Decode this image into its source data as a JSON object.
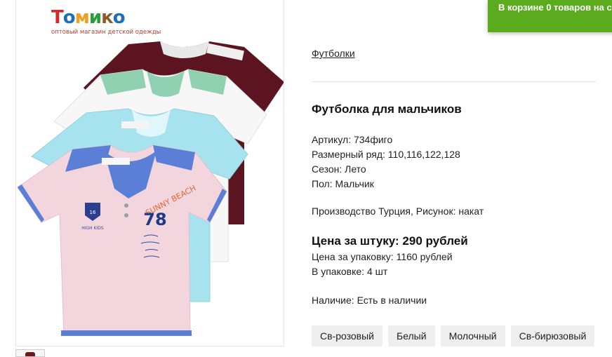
{
  "logo": {
    "brand": "Томико",
    "letters": [
      "Т",
      "о",
      "м",
      "и",
      "к",
      "о"
    ],
    "tagline": "оптовый магазин детской одежды"
  },
  "product_image": {
    "print_text": "SUNNY BEACH",
    "print_number": "78",
    "badge_text": "HIGH KIDS"
  },
  "cart": {
    "prefix": "В корзине",
    "count": "0 товаров",
    "suffix": "на су"
  },
  "breadcrumb": "Футболки",
  "title": "Футболка для мальчиков",
  "props": {
    "article": "Артикул: 734фиго",
    "sizes": "Размерный ряд: 110,116,122,128",
    "season": "Сезон: Лето",
    "gender": "Пол: Мальчик"
  },
  "production": "Производство Турция, Рисунок: накат",
  "price": {
    "per_item": "Цена за штуку: 290 рублей",
    "per_pack": "Цена за упаковку: 1160 рублей",
    "pack_size": "В упаковке: 4 шт"
  },
  "stock": "Наличие: Есть в наличии",
  "colors": [
    "Св-розовый",
    "Белый",
    "Молочный",
    "Св-бирюзовый"
  ],
  "palette": {
    "cart_green": "#5aab1e",
    "shirt_burgundy": "#5c1520",
    "shirt_white": "#f7f7f7",
    "shirt_cyan": "#a6e3ee",
    "shirt_pink": "#f3d6dd",
    "accent_blue": "#5b7fd6",
    "accent_mint": "#8fd1b0"
  }
}
